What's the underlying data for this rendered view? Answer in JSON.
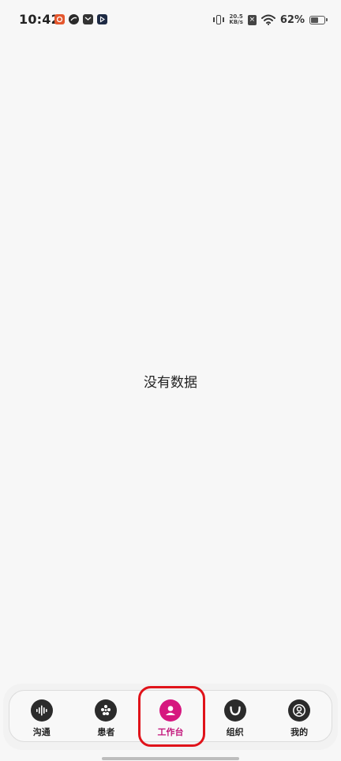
{
  "status_bar": {
    "time": "10:42",
    "network_speed_value": "20.5",
    "network_speed_unit": "KB/s",
    "battery_percent": "62%",
    "battery_level": 0.62
  },
  "main": {
    "empty_message": "没有数据"
  },
  "bottom_nav": {
    "active_index": 2,
    "accent_color": "#d6177f",
    "highlight_color": "#e0131a",
    "tabs": [
      {
        "label": "沟通",
        "icon": "sound-wave-icon"
      },
      {
        "label": "患者",
        "icon": "dots-cluster-icon"
      },
      {
        "label": "工作台",
        "icon": "workbench-person-icon"
      },
      {
        "label": "组织",
        "icon": "smile-arc-icon"
      },
      {
        "label": "我的",
        "icon": "profile-icon"
      }
    ]
  }
}
